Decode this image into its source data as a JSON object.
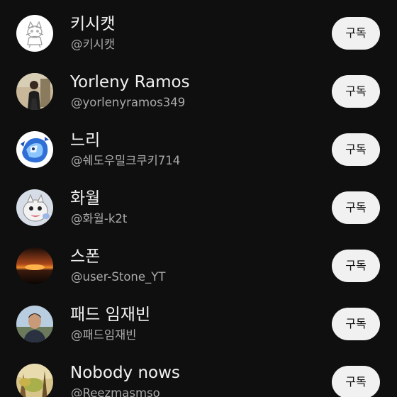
{
  "channels": [
    {
      "name": "키시캣",
      "handle": "@키시캣",
      "subscribe_label": "구독",
      "avatar": "cat-sketch-avatar"
    },
    {
      "name": "Yorleny Ramos",
      "handle": "@yorlenyramos349",
      "subscribe_label": "구독",
      "avatar": "person-photo-avatar"
    },
    {
      "name": "느리",
      "handle": "@쉐도우밀크쿠키714",
      "subscribe_label": "구독",
      "avatar": "blue-character-avatar"
    },
    {
      "name": "화월",
      "handle": "@화월-k2t",
      "subscribe_label": "구독",
      "avatar": "cartoon-creature-avatar"
    },
    {
      "name": "스폰",
      "handle": "@user-Stone_YT",
      "subscribe_label": "구독",
      "avatar": "sunset-avatar"
    },
    {
      "name": "패드 임재빈",
      "handle": "@패드임재빈",
      "subscribe_label": "구독",
      "avatar": "man-photo-avatar"
    },
    {
      "name": "Nobody nows",
      "handle": "@Reezmasmso",
      "subscribe_label": "구독",
      "avatar": "forest-avatar"
    }
  ]
}
